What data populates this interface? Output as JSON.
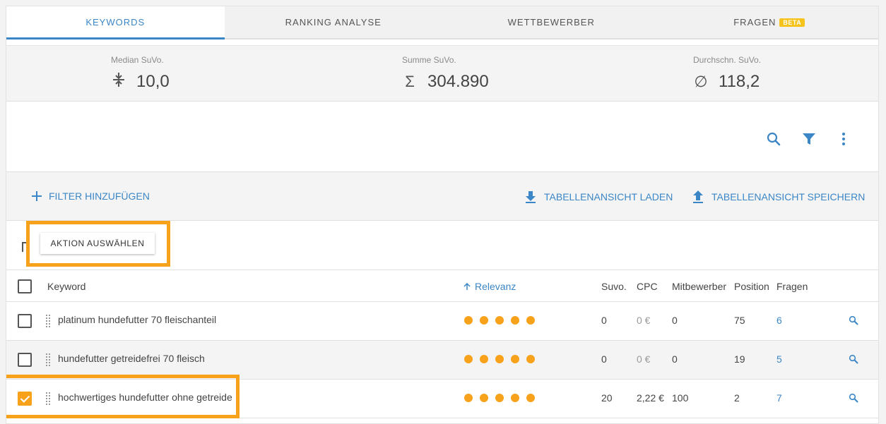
{
  "tabs": [
    {
      "label": "KEYWORDS",
      "active": true
    },
    {
      "label": "RANKING ANALYSE"
    },
    {
      "label": "WETTBEWERBER"
    },
    {
      "label": "FRAGEN",
      "badge": "BETA"
    }
  ],
  "stats": [
    {
      "label": "Median SuVo.",
      "symbol": "median-icon",
      "value": "10,0"
    },
    {
      "label": "Summe SuVo.",
      "symbol": "Σ",
      "value": "304.890"
    },
    {
      "label": "Durchschn. SuVo.",
      "symbol": "∅",
      "value": "118,2"
    }
  ],
  "toolbar": {
    "icons": [
      "search-icon",
      "filter-icon",
      "more-vert-icon"
    ]
  },
  "filterbar": {
    "add_filter": "FILTER HINZUFÜGEN",
    "load_view": "TABELLENANSICHT LADEN",
    "save_view": "TABELLENANSICHT SPEICHERN"
  },
  "action": {
    "label": "AKTION AUSWÄHLEN"
  },
  "table": {
    "headers": {
      "keyword": "Keyword",
      "relevance": "Relevanz",
      "suvo": "Suvo.",
      "cpc": "CPC",
      "competitors": "Mitbewerber",
      "position": "Position",
      "questions": "Fragen"
    },
    "sort": {
      "column": "relevance",
      "direction": "ascending"
    },
    "rows": [
      {
        "keyword": "platinum hundefutter 70 fleischanteil",
        "relevance": 5,
        "suvo": "0",
        "cpc": "0 €",
        "competitors": "0",
        "position": "75",
        "questions": "6",
        "checked": false
      },
      {
        "keyword": "hundefutter getreidefrei 70 fleisch",
        "relevance": 5,
        "suvo": "0",
        "cpc": "0 €",
        "competitors": "0",
        "position": "19",
        "questions": "5",
        "checked": false
      },
      {
        "keyword": "hochwertiges hundefutter ohne getreide",
        "relevance": 5,
        "suvo": "20",
        "cpc": "2,22 €",
        "competitors": "100",
        "position": "2",
        "questions": "7",
        "checked": true
      }
    ]
  },
  "colors": {
    "accent": "#3b86c6",
    "highlight": "#f8a21b",
    "badge": "#f7c21a"
  }
}
